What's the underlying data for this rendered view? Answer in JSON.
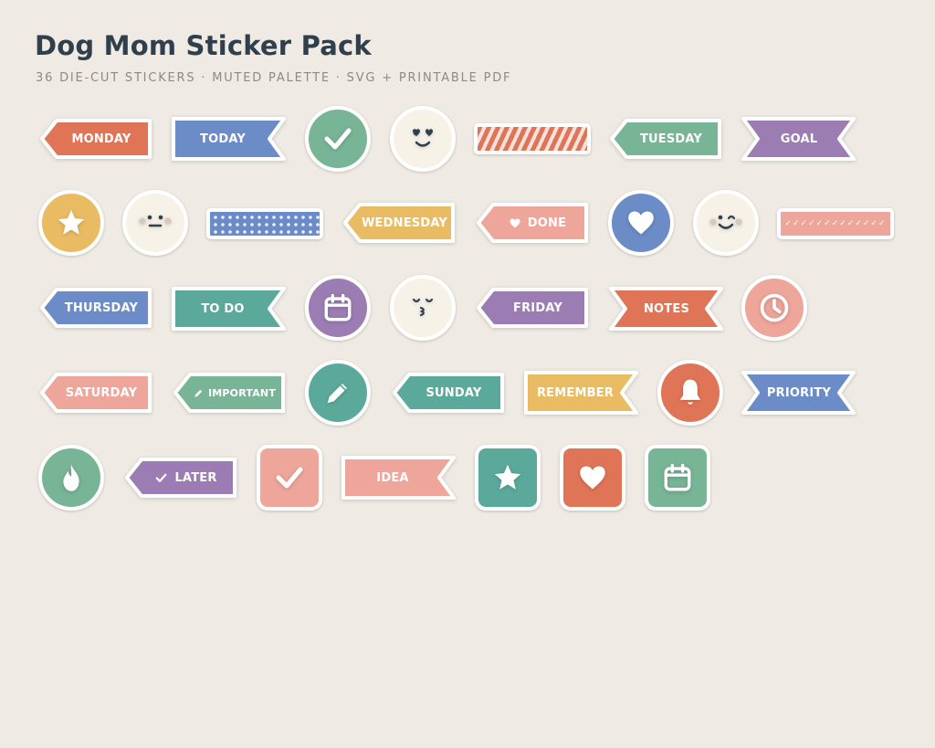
{
  "header": {
    "title": "Dog Mom Sticker Pack",
    "subtitle": "36 DIE-CUT STICKERS · MUTED PALETTE · SVG + PRINTABLE PDF"
  },
  "palette": {
    "coral": "#e07456",
    "blue": "#6b8cc6",
    "sage": "#7ab597",
    "cream": "#f6f2e8",
    "green": "#78b496",
    "purple": "#9b7db3",
    "mustard": "#e9bc63",
    "pink": "#eea59a",
    "teal": "#5ba99b"
  },
  "stickers": {
    "monday": {
      "label": "MONDAY",
      "color": "#e07456"
    },
    "today": {
      "label": "TODAY",
      "color": "#6b8cc6"
    },
    "check_circle": {
      "icon": "check-icon",
      "color": "#78b496"
    },
    "smile_face": {
      "icon": "smile-face-icon",
      "color": "#f6f2e8"
    },
    "stripe_strip": {
      "icon": "diagonal-stripes",
      "color": "#e07456"
    },
    "tuesday": {
      "label": "TUESDAY",
      "color": "#78b496"
    },
    "goal": {
      "label": "GOAL",
      "color": "#9b7db3"
    },
    "star_circle": {
      "icon": "star-icon",
      "color": "#e9bc63"
    },
    "neutral_face": {
      "icon": "neutral-face-icon",
      "color": "#f6f2e8"
    },
    "dot_strip": {
      "icon": "polka-dots",
      "color": "#6b8cc6"
    },
    "wednesday": {
      "label": "WEDNESDAY",
      "color": "#e9bc63"
    },
    "done": {
      "label": "DONE",
      "color": "#eea59a",
      "icon": "heart-icon"
    },
    "heart_circle": {
      "icon": "heart-icon",
      "color": "#6b8cc6"
    },
    "wink_face": {
      "icon": "wink-face-icon",
      "color": "#f6f2e8"
    },
    "check_strip": {
      "text": "✓✓✓✓✓✓✓✓✓✓✓✓✓",
      "color": "#eea59a"
    },
    "thursday": {
      "label": "THURSDAY",
      "color": "#6b8cc6"
    },
    "todo": {
      "label": "TO DO",
      "color": "#5ba99b"
    },
    "calendar_circle": {
      "icon": "calendar-icon",
      "color": "#9b7db3"
    },
    "kiss_face": {
      "icon": "kiss-face-icon",
      "color": "#f6f2e8"
    },
    "friday": {
      "label": "FRIDAY",
      "color": "#9b7db3"
    },
    "notes": {
      "label": "NOTES",
      "color": "#e07456"
    },
    "clock_circle": {
      "icon": "clock-icon",
      "color": "#eea59a"
    },
    "saturday": {
      "label": "SATURDAY",
      "color": "#eea59a"
    },
    "important": {
      "label": "IMPORTANT",
      "color": "#78b496",
      "icon": "pencil-icon"
    },
    "pencil_circle": {
      "icon": "pencil-icon",
      "color": "#5ba99b"
    },
    "sunday": {
      "label": "SUNDAY",
      "color": "#5ba99b"
    },
    "remember": {
      "label": "REMEMBER",
      "color": "#e9bc63"
    },
    "bell_circle": {
      "icon": "bell-icon",
      "color": "#e07456"
    },
    "priority": {
      "label": "PRIORITY",
      "color": "#6b8cc6"
    },
    "flame_circle": {
      "icon": "flame-icon",
      "color": "#78b496"
    },
    "later": {
      "label": "LATER",
      "color": "#9b7db3",
      "icon": "check-icon"
    },
    "check_square": {
      "icon": "check-icon",
      "color": "#eea59a"
    },
    "idea": {
      "label": "IDEA",
      "color": "#eea59a"
    },
    "star_square": {
      "icon": "star-icon",
      "color": "#5ba99b"
    },
    "heart_square": {
      "icon": "heart-icon",
      "color": "#e07456"
    },
    "calendar_square": {
      "icon": "calendar-icon",
      "color": "#78b496"
    }
  }
}
